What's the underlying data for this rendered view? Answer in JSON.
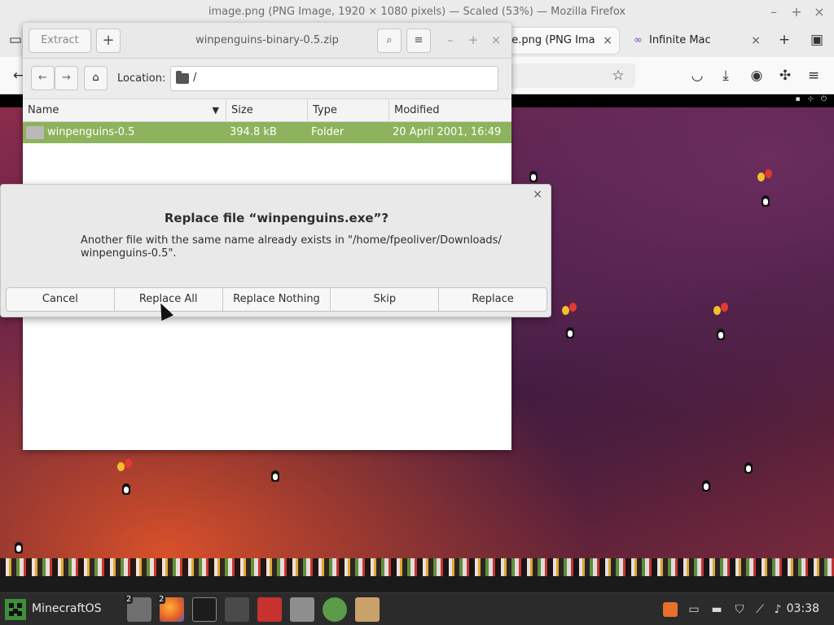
{
  "browser": {
    "window_title": "image.png (PNG Image, 1920 × 1080 pixels) — Scaled (53%) — Mozilla Firefox",
    "tabs": [
      {
        "label": "age.png (PNG Ima",
        "active": true
      },
      {
        "label": "Infinite Mac",
        "active": false
      }
    ]
  },
  "archive": {
    "title": "winpenguins-binary-0.5.zip",
    "extract_label": "Extract",
    "location_label": "Location:",
    "location_value": "/",
    "columns": [
      "Name",
      "Size",
      "Type",
      "Modified"
    ],
    "rows": [
      {
        "name": "winpenguins-0.5",
        "size": "394.8 kB",
        "type": "Folder",
        "modified": "20 April 2001, 16:49"
      }
    ]
  },
  "dialog": {
    "title": "Replace file “winpenguins.exe”?",
    "message": "Another file with the same name already exists in \"/home/fpeoliver/Downloads/ winpenguins-0.5\".",
    "buttons": [
      "Cancel",
      "Replace All",
      "Replace Nothing",
      "Skip",
      "Replace"
    ]
  },
  "taskbar": {
    "menu_label": "MinecraftOS",
    "badges": [
      "2",
      "2"
    ],
    "clock": "03:38"
  },
  "colors": {
    "selection": "#8db35c",
    "taskbar": "#2b2b2b",
    "firefox_chrome": "#ebebeb"
  }
}
